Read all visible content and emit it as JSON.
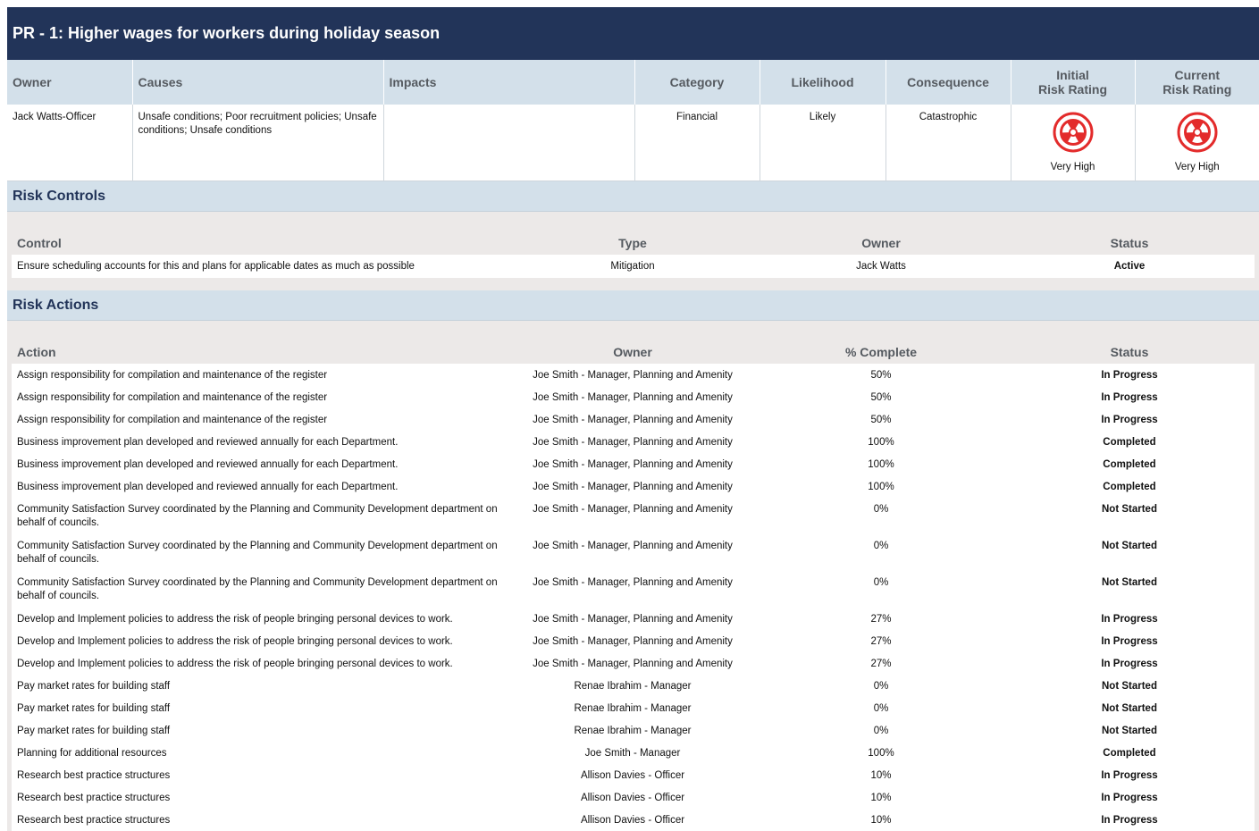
{
  "title": "PR - 1: Higher wages for workers during holiday season",
  "risk": {
    "headers": {
      "owner": "Owner",
      "causes": "Causes",
      "impacts": "Impacts",
      "category": "Category",
      "likelihood": "Likelihood",
      "consequence": "Consequence",
      "initial_line1": "Initial",
      "initial_line2": "Risk Rating",
      "current_line1": "Current",
      "current_line2": "Risk Rating"
    },
    "row": {
      "owner": "Jack Watts-Officer",
      "causes": "Unsafe conditions; Poor recruitment policies; Unsafe conditions; Unsafe conditions",
      "impacts": "",
      "category": "Financial",
      "likelihood": "Likely",
      "consequence": "Catastrophic",
      "initial_rating": "Very High",
      "current_rating": "Very High"
    },
    "rating_icon": "hazard-icon",
    "rating_color": "#e32b2b"
  },
  "controls": {
    "title": "Risk Controls",
    "headers": {
      "control": "Control",
      "type": "Type",
      "owner": "Owner",
      "status": "Status"
    },
    "rows": [
      {
        "control": "Ensure scheduling accounts for this and plans for applicable dates as much as possible",
        "type": "Mitigation",
        "owner": "Jack Watts",
        "status": "Active"
      }
    ]
  },
  "actions": {
    "title": "Risk Actions",
    "headers": {
      "action": "Action",
      "owner": "Owner",
      "complete": "% Complete",
      "status": "Status"
    },
    "rows": [
      {
        "action": "Assign responsibility for compilation and maintenance of the register",
        "owner": "Joe Smith - Manager, Planning and Amenity",
        "complete": "50%",
        "status": "In Progress"
      },
      {
        "action": "Assign responsibility for compilation and maintenance of the register",
        "owner": "Joe Smith - Manager, Planning and Amenity",
        "complete": "50%",
        "status": "In Progress"
      },
      {
        "action": "Assign responsibility for compilation and maintenance of the register",
        "owner": "Joe Smith - Manager, Planning and Amenity",
        "complete": "50%",
        "status": "In Progress"
      },
      {
        "action": "Business improvement plan developed and reviewed annually for each Department.",
        "owner": "Joe Smith - Manager, Planning and Amenity",
        "complete": "100%",
        "status": "Completed"
      },
      {
        "action": "Business improvement plan developed and reviewed annually for each Department.",
        "owner": "Joe Smith - Manager, Planning and Amenity",
        "complete": "100%",
        "status": "Completed"
      },
      {
        "action": "Business improvement plan developed and reviewed annually for each Department.",
        "owner": "Joe Smith - Manager, Planning and Amenity",
        "complete": "100%",
        "status": "Completed"
      },
      {
        "action": "Community Satisfaction Survey coordinated by the Planning and Community Development department on behalf of councils.",
        "owner": "Joe Smith - Manager, Planning and Amenity",
        "complete": "0%",
        "status": "Not Started"
      },
      {
        "action": "Community Satisfaction Survey coordinated by the Planning and Community Development department on behalf of councils.",
        "owner": "Joe Smith - Manager, Planning and Amenity",
        "complete": "0%",
        "status": "Not Started"
      },
      {
        "action": "Community Satisfaction Survey coordinated by the Planning and Community Development department on behalf of councils.",
        "owner": "Joe Smith - Manager, Planning and Amenity",
        "complete": "0%",
        "status": "Not Started"
      },
      {
        "action": "Develop and Implement policies to address the risk of people bringing personal devices to work.",
        "owner": "Joe Smith - Manager, Planning and Amenity",
        "complete": "27%",
        "status": "In Progress"
      },
      {
        "action": "Develop and Implement policies to address the risk of people bringing personal devices to work.",
        "owner": "Joe Smith - Manager, Planning and Amenity",
        "complete": "27%",
        "status": "In Progress"
      },
      {
        "action": "Develop and Implement policies to address the risk of people bringing personal devices to work.",
        "owner": "Joe Smith - Manager, Planning and Amenity",
        "complete": "27%",
        "status": "In Progress"
      },
      {
        "action": "Pay market rates for building staff",
        "owner": "Renae Ibrahim - Manager",
        "complete": "0%",
        "status": "Not Started"
      },
      {
        "action": "Pay market rates for building staff",
        "owner": "Renae Ibrahim - Manager",
        "complete": "0%",
        "status": "Not Started"
      },
      {
        "action": "Pay market rates for building staff",
        "owner": "Renae Ibrahim - Manager",
        "complete": "0%",
        "status": "Not Started"
      },
      {
        "action": "Planning for additional resources",
        "owner": "Joe Smith - Manager",
        "complete": "100%",
        "status": "Completed"
      },
      {
        "action": "Research best practice structures",
        "owner": "Allison Davies - Officer",
        "complete": "10%",
        "status": "In Progress"
      },
      {
        "action": "Research best practice structures",
        "owner": "Allison Davies - Officer",
        "complete": "10%",
        "status": "In Progress"
      },
      {
        "action": "Research best practice structures",
        "owner": "Allison Davies - Officer",
        "complete": "10%",
        "status": "In Progress"
      }
    ]
  }
}
